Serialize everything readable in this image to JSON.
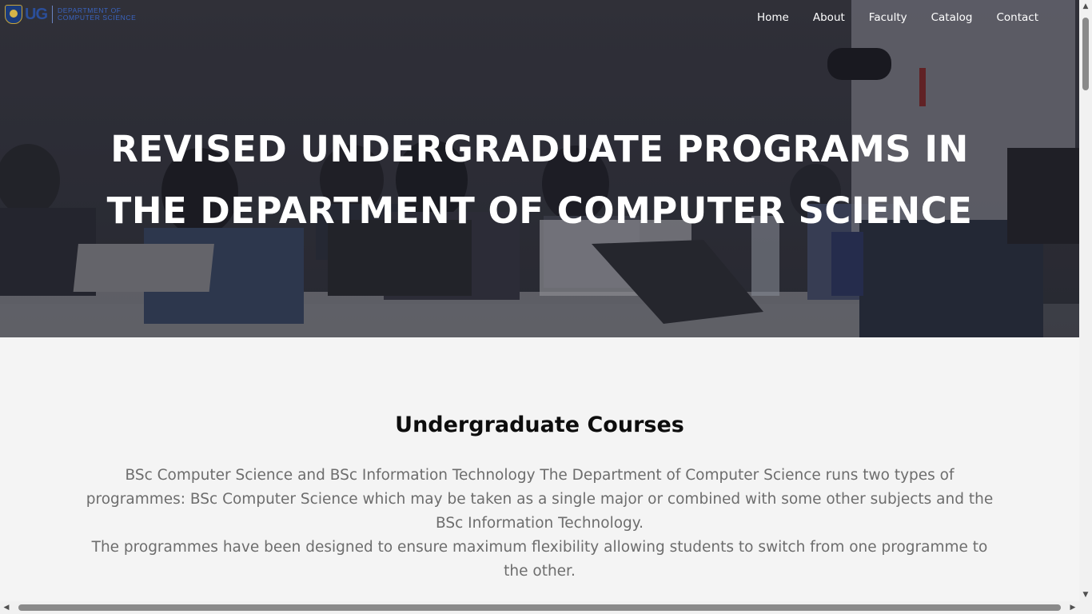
{
  "logo": {
    "main": "UG",
    "sub_line1": "Department of",
    "sub_line2": "Computer Science"
  },
  "nav": {
    "items": [
      {
        "label": "Home"
      },
      {
        "label": "About"
      },
      {
        "label": "Faculty"
      },
      {
        "label": "Catalog"
      },
      {
        "label": "Contact"
      }
    ]
  },
  "hero": {
    "title": "REVISED UNDERGRADUATE PROGRAMS IN THE DEPARTMENT OF COMPUTER SCIENCE",
    "background": "classroom-students-laptops-image"
  },
  "courses": {
    "heading": "Undergraduate Courses",
    "paragraph1": "BSc Computer Science and BSc Information Technology The Department of Computer Science runs two types of programmes: BSc Computer Science which may be taken as a single major or combined with some other subjects and the BSc Information Technology.",
    "paragraph2": "The programmes have been designed to ensure maximum flexibility allowing students to switch from one programme to the other."
  },
  "colors": {
    "hero_dark": "#3a3b44",
    "page_bg": "#f4f4f4",
    "heading": "#0d0d0d",
    "body_text": "#6d6d6d",
    "logo_blue": "#2b4f9b"
  }
}
